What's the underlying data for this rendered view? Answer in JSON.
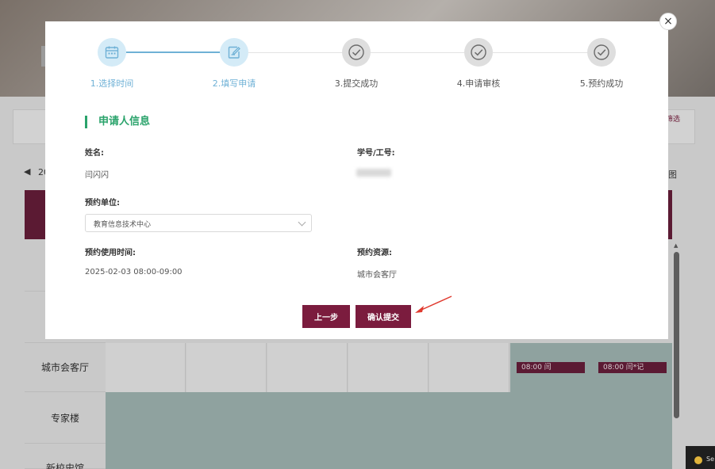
{
  "background": {
    "filter_text": "筛选",
    "date_text": "20",
    "view_text": "图",
    "rows": [
      {
        "label": "城市会客厅"
      },
      {
        "label": "专家楼"
      },
      {
        "label": "新校史馆"
      }
    ],
    "bookings": [
      {
        "text": "08:00 闫"
      },
      {
        "text": "08:00 闫*记"
      }
    ],
    "corner_text": "Se"
  },
  "modal": {
    "close_label": "×",
    "steps": [
      {
        "label": "1.选择时间",
        "state": "active",
        "icon": "calendar-icon"
      },
      {
        "label": "2.填写申请",
        "state": "active",
        "icon": "edit-form-icon"
      },
      {
        "label": "3.提交成功",
        "state": "pending",
        "icon": "check-circle-icon"
      },
      {
        "label": "4.申请审核",
        "state": "pending",
        "icon": "check-circle-icon"
      },
      {
        "label": "5.预约成功",
        "state": "pending",
        "icon": "check-circle-icon"
      }
    ],
    "section_title": "申请人信息",
    "fields": {
      "name_label": "姓名:",
      "name_value": "闫闪闪",
      "id_label": "学号/工号:",
      "unit_label": "预约单位:",
      "unit_value": "教育信息技术中心",
      "time_label": "预约使用时间:",
      "time_value": "2025-02-03 08:00-09:00",
      "resource_label": "预约资源:",
      "resource_value": "城市会客厅"
    },
    "buttons": {
      "prev": "上一步",
      "confirm": "确认提交"
    }
  },
  "colors": {
    "accent": "#7b1c3e",
    "step_active": "#6fb1d6",
    "section_green": "#2aa36b"
  }
}
